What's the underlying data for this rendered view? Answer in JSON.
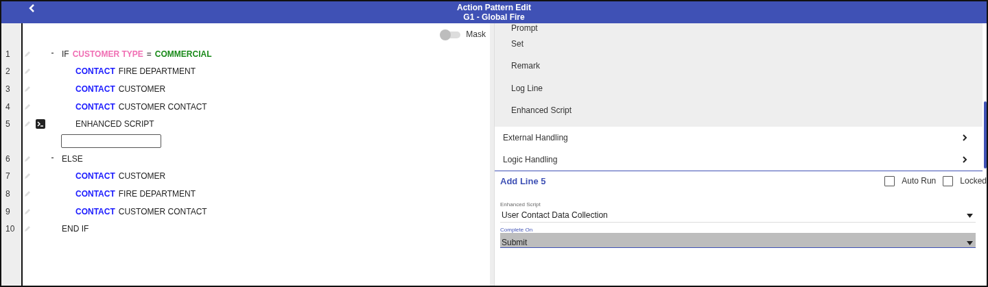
{
  "header": {
    "title": "Action Pattern Edit",
    "subtitle": "G1 - Global Fire"
  },
  "editor": {
    "mask": {
      "label": "Mask",
      "on": false
    },
    "lines": [
      {
        "number": "1",
        "kind": "statement",
        "expanded": true,
        "tokens": [
          {
            "text": "IF",
            "kind": "plain"
          },
          {
            "text": "CUSTOMER TYPE",
            "kind": "field"
          },
          {
            "text": "=",
            "kind": "plain"
          },
          {
            "text": "COMMERCIAL",
            "kind": "value"
          }
        ],
        "children": [
          {
            "number": "2",
            "kind": "statement",
            "tokens": [
              {
                "text": "CONTACT",
                "kind": "keyword"
              },
              {
                "text": "FIRE DEPARTMENT",
                "kind": "plain"
              }
            ]
          },
          {
            "number": "3",
            "kind": "statement",
            "tokens": [
              {
                "text": "CONTACT",
                "kind": "keyword"
              },
              {
                "text": "CUSTOMER",
                "kind": "plain"
              }
            ]
          },
          {
            "number": "4",
            "kind": "statement",
            "tokens": [
              {
                "text": "CONTACT",
                "kind": "keyword"
              },
              {
                "text": "CUSTOMER CONTACT",
                "kind": "plain"
              }
            ]
          },
          {
            "number": "5",
            "kind": "script",
            "tokens": [
              {
                "text": "ENHANCED SCRIPT",
                "kind": "plain"
              }
            ]
          }
        ]
      },
      {
        "kind": "input"
      },
      {
        "number": "6",
        "kind": "statement",
        "expanded": true,
        "tokens": [
          {
            "text": "ELSE",
            "kind": "plain"
          }
        ],
        "children": [
          {
            "number": "7",
            "kind": "statement",
            "tokens": [
              {
                "text": "CONTACT",
                "kind": "keyword"
              },
              {
                "text": "CUSTOMER",
                "kind": "plain"
              }
            ]
          },
          {
            "number": "8",
            "kind": "statement",
            "tokens": [
              {
                "text": "CONTACT",
                "kind": "keyword"
              },
              {
                "text": "FIRE DEPARTMENT",
                "kind": "plain"
              }
            ]
          },
          {
            "number": "9",
            "kind": "statement",
            "tokens": [
              {
                "text": "CONTACT",
                "kind": "keyword"
              },
              {
                "text": "CUSTOMER CONTACT",
                "kind": "plain"
              }
            ]
          }
        ]
      },
      {
        "number": "10",
        "kind": "statement",
        "tokens": [
          {
            "text": "END IF",
            "kind": "plain"
          }
        ]
      }
    ]
  },
  "menu": {
    "sub_items": [
      "Prompt",
      "Set",
      "Remark",
      "Log Line",
      "Enhanced Script"
    ],
    "groups": [
      {
        "label": "External Handling"
      },
      {
        "label": "Logic Handling"
      }
    ]
  },
  "form": {
    "title": "Add Line 5",
    "checkboxes": [
      {
        "label": "Auto Run",
        "checked": false
      },
      {
        "label": "Locked",
        "checked": false
      }
    ],
    "fields": [
      {
        "label": "Enhanced Script",
        "value": "User Contact Data Collection",
        "focused": false
      },
      {
        "label": "Complete On",
        "value": "Submit",
        "focused": true
      }
    ]
  }
}
